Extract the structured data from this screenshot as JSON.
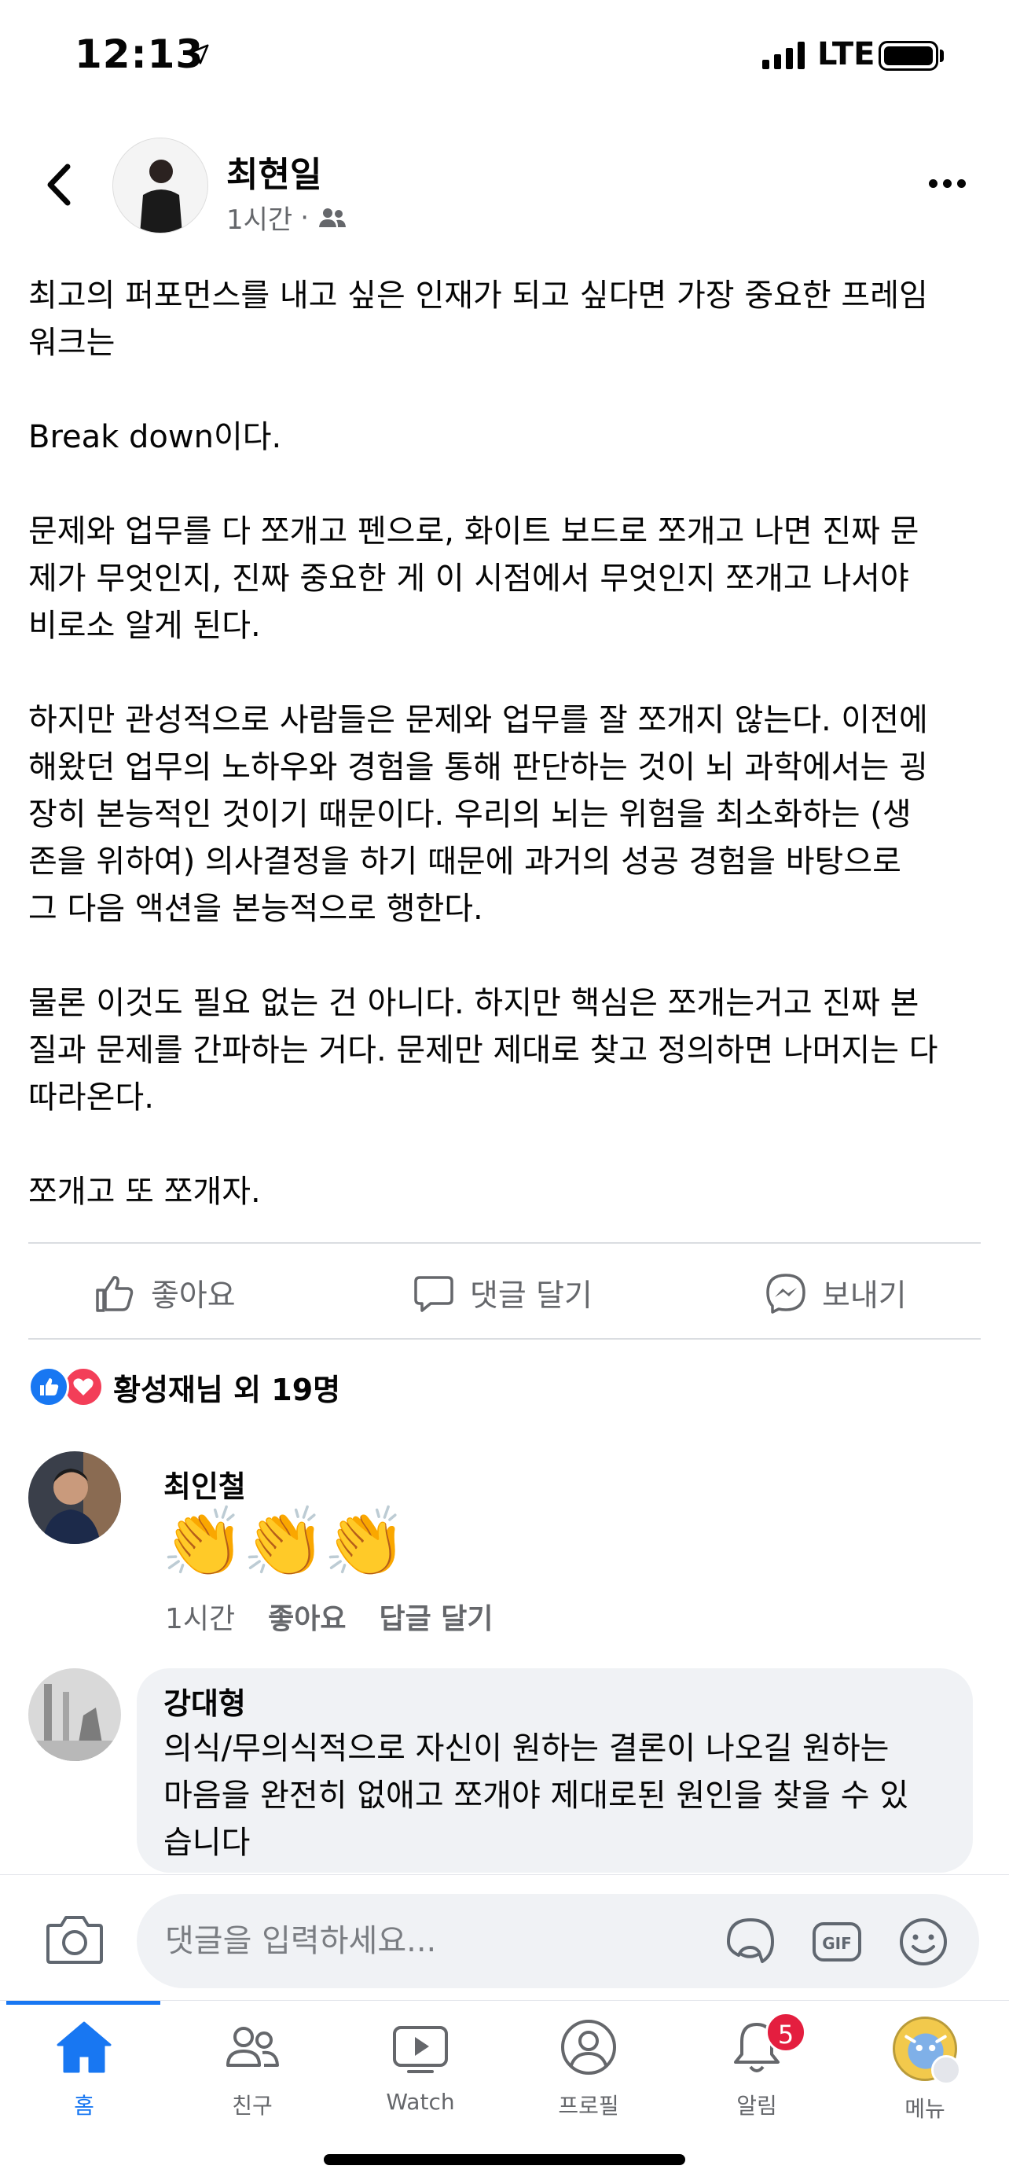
{
  "status_bar": {
    "time": "12:13",
    "network": "LTE"
  },
  "post": {
    "author": "최현일",
    "time": "1시간",
    "meta_sep": "·",
    "paragraphs": [
      "최고의 퍼포먼스를 내고 싶은 인재가 되고 싶다면 가장 중요한 프레임\n워크는",
      "Break down이다.",
      "문제와 업무를 다 쪼개고 펜으로, 화이트 보드로 쪼개고 나면 진짜 문\n제가 무엇인지, 진짜 중요한 게 이 시점에서 무엇인지 쪼개고 나서야\n비로소 알게 된다.",
      "하지만 관성적으로 사람들은 문제와 업무를 잘 쪼개지 않는다. 이전에\n해왔던 업무의 노하우와 경험을 통해 판단하는 것이 뇌 과학에서는 굉\n장히 본능적인 것이기 때문이다. 우리의 뇌는 위험을 최소화하는 (생\n존을 위하여) 의사결정을 하기 때문에 과거의 성공 경험을 바탕으로\n그 다음 액션을 본능적으로 행한다.",
      "물론 이것도 필요 없는 건 아니다. 하지만 핵심은 쪼개는거고 진짜 본\n질과 문제를 간파하는 거다. 문제만 제대로 찾고 정의하면 나머지는 다\n따라온다.",
      "쪼개고 또 쪼개자."
    ]
  },
  "actions": {
    "like": "좋아요",
    "comment": "댓글 달기",
    "send": "보내기"
  },
  "reactions": {
    "summary": "황성재님 외 19명"
  },
  "comments": [
    {
      "name": "최인철",
      "emoji": "👏👏👏",
      "time": "1시간",
      "like": "좋아요",
      "reply": "답글 달기"
    },
    {
      "name": "강대형",
      "text": "의식/무의식적으로 자신이 원하는 결론이 나오길 원하는\n마음을 완전히 없애고 쪼개야 제대로된 원인을 찾을 수 있\n습니다"
    }
  ],
  "composer": {
    "placeholder": "댓글을 입력하세요..."
  },
  "tabs": [
    {
      "label": "홈",
      "icon": "home-icon"
    },
    {
      "label": "친구",
      "icon": "friends-icon"
    },
    {
      "label": "Watch",
      "icon": "watch-icon"
    },
    {
      "label": "프로필",
      "icon": "profile-icon"
    },
    {
      "label": "알림",
      "icon": "bell-icon",
      "badge": "5"
    },
    {
      "label": "메뉴",
      "icon": "menu-avatar"
    }
  ],
  "colors": {
    "brand": "#1877f2",
    "text": "#050505",
    "muted": "#65676b",
    "badge": "#e41e3f",
    "love": "#f33e58"
  }
}
